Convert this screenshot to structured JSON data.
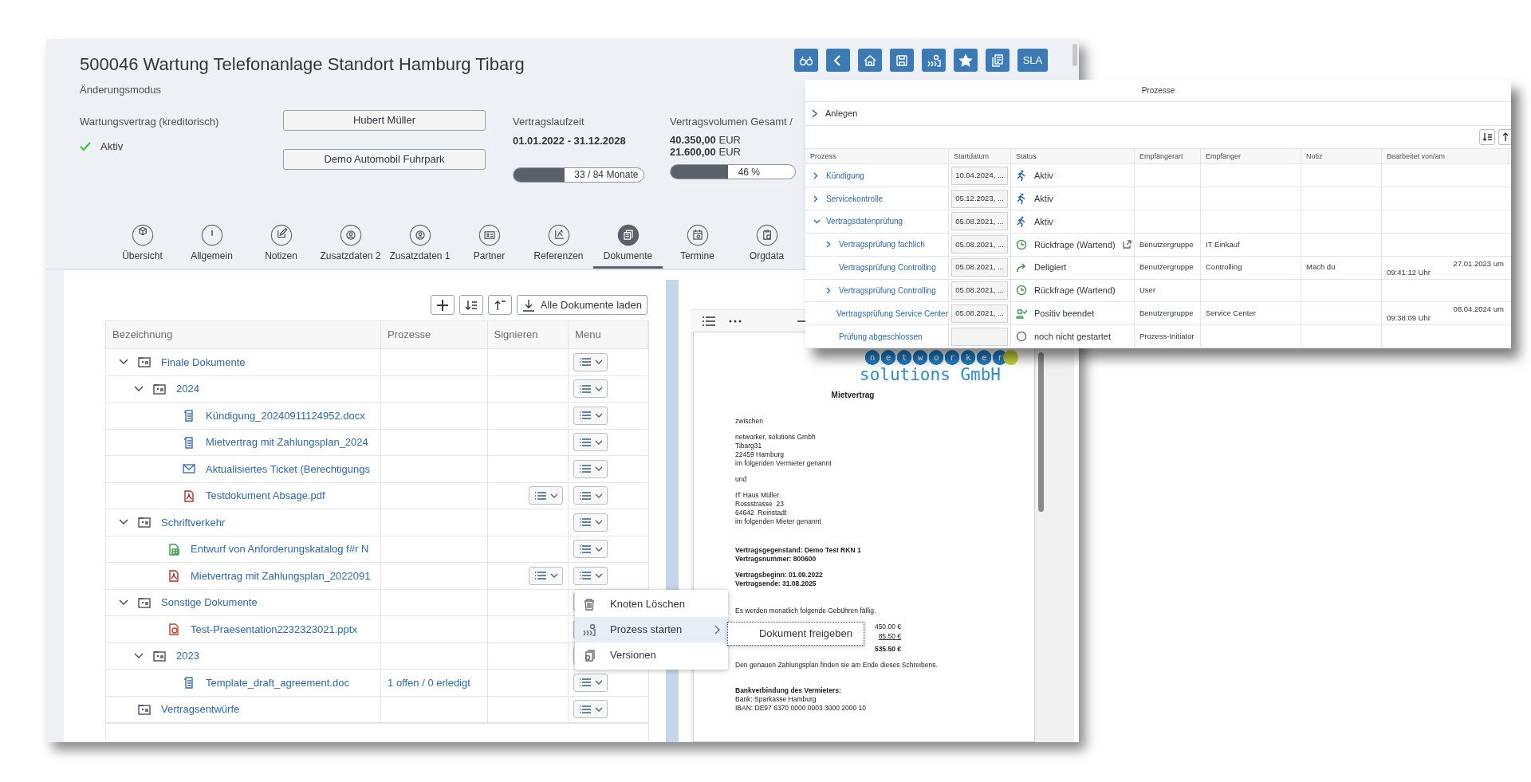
{
  "header": {
    "title": "500046 Wartung Telefonanlage Standort Hamburg Tibarg",
    "subtitle": "Änderungsmodus",
    "actions": [
      {
        "kind": "glasses"
      },
      {
        "kind": "back"
      },
      {
        "kind": "home"
      },
      {
        "kind": "save"
      },
      {
        "kind": "process"
      },
      {
        "kind": "favorite"
      },
      {
        "kind": "copy"
      },
      {
        "kind": "text",
        "label": "SLA"
      }
    ],
    "contract": {
      "type": "Wartungsvertrag (kreditorisch)",
      "status": "Aktiv"
    },
    "partners": [
      "Hubert Müller",
      "Demo Automobil Fuhrpark"
    ],
    "term": {
      "label": "Vertragslaufzeit",
      "dates": "01.01.2022 - 31.12.2028",
      "level": 0.39,
      "reading": "33 / 84 Monate"
    },
    "volume": {
      "label": "Vertragsvolumen Gesamt /",
      "amounts": [
        "**40.350,00** EUR",
        "**21.600,00** EUR"
      ],
      "level": 0.46,
      "reading": "46 %"
    }
  },
  "tabs": [
    {
      "label": "Übersicht",
      "kind": "box",
      "selected": false
    },
    {
      "label": "Allgemein",
      "kind": "info",
      "selected": false
    },
    {
      "label": "Notizen",
      "kind": "edit",
      "selected": false
    },
    {
      "label": "Zusatzdaten 2",
      "kind": "person",
      "selected": false
    },
    {
      "label": "Zusatzdaten 1",
      "kind": "person",
      "selected": false
    },
    {
      "label": "Partner",
      "kind": "card",
      "selected": false
    },
    {
      "label": "Referenzen",
      "kind": "axes",
      "selected": false
    },
    {
      "label": "Dokumente",
      "kind": "documents",
      "selected": true
    },
    {
      "label": "Termine",
      "kind": "calendar",
      "selected": false
    },
    {
      "label": "Orgdata",
      "kind": "clipboard",
      "selected": false
    }
  ],
  "documents": {
    "toolbar": [
      {
        "kind": "add"
      },
      {
        "kind": "sort_down"
      },
      {
        "kind": "sort_up"
      },
      {
        "kind": "download",
        "label": "Alle Dokumente laden"
      }
    ],
    "columns": [
      "Bezeichnung",
      "Prozesse",
      "Signieren",
      "Menu"
    ],
    "tree": [
      {
        "kind": "folder",
        "name": "Finale Dokumente",
        "expanded": true,
        "children": [
          {
            "kind": "folder",
            "name": "2024",
            "expanded": true,
            "children": [
              {
                "kind": "word",
                "name": "Kündigung_20240911124952.docx"
              },
              {
                "kind": "word",
                "name": "Mietvertrag mit Zahlungsplan_2024"
              },
              {
                "kind": "mail",
                "name": "Aktualisiertes Ticket (Berechtigungs"
              },
              {
                "kind": "pdf",
                "name": "Testdokument Absage.pdf",
                "signable": true
              }
            ]
          }
        ]
      },
      {
        "kind": "folder",
        "name": "Schriftverkehr",
        "expanded": true,
        "children": [
          {
            "kind": "sheet",
            "name": "Entwurf von Anforderungskatalog f#r N"
          },
          {
            "kind": "pdf",
            "name": "Mietvertrag mit Zahlungsplan_2022091",
            "signable": true
          }
        ]
      },
      {
        "kind": "folder",
        "name": "Sonstige Dokumente",
        "expanded": true,
        "children": [
          {
            "kind": "slides",
            "name": "Test-Praesentation2232323021.pptx"
          },
          {
            "kind": "folder",
            "name": "2023",
            "expanded": true,
            "children": [
              {
                "kind": "word",
                "name": "Template_draft_agreement.doc",
                "processes": "1 offen / 0 erledigt"
              }
            ]
          }
        ]
      },
      {
        "kind": "folder",
        "name": "Vertragsentwürfe"
      }
    ]
  },
  "context_menu": {
    "items": [
      {
        "kind": "trash",
        "label": "Knoten Löschen",
        "selected": false
      },
      {
        "kind": "process",
        "label": "Prozess starten",
        "selected": true,
        "submenu": [
          "Dokument freigeben"
        ]
      },
      {
        "kind": "versions",
        "label": "Versionen",
        "selected": false
      }
    ]
  },
  "preview": {
    "logo": "networker",
    "logo_sub": "solutions GmbH",
    "title": "Mietvertrag",
    "blocks": [
      {
        "kind": "text",
        "lines": [
          "zwischen"
        ]
      },
      {
        "kind": "text",
        "lines": [
          "networker, solutions Gmbh",
          "Tibarg31",
          "22459 Hamburg",
          "im folgenden Vermieter genannt"
        ]
      },
      {
        "kind": "text",
        "lines": [
          "und"
        ]
      },
      {
        "kind": "text",
        "lines": [
          "IT Haus Müller",
          "Rossstrasse  23",
          "64642  Reinstadt",
          "im folgenden Mieter genannt"
        ]
      },
      {
        "kind": "bold",
        "lines": [
          "Vertragsgegenstand: Demo Test RKN 1",
          "Vertragsnummer: 800600"
        ]
      },
      {
        "kind": "bold",
        "lines": [
          "Vertragsbeginn: 01.09.2022",
          "Vertragsende: 31.08.2025"
        ]
      },
      {
        "kind": "text",
        "lines": [
          "Es werden monatlich folgende Gebühren fällig."
        ]
      },
      {
        "kind": "fees",
        "amounts": [
          {
            "kind": "plain",
            "value": "450.00 €"
          },
          {
            "kind": "underlined",
            "value": "85.50 €"
          },
          {
            "kind": "total",
            "value": "535.50 €"
          }
        ]
      },
      {
        "kind": "text",
        "lines": [
          "Den genauen Zahlungsplan finden sie am Ende dieses Schreibens."
        ]
      },
      {
        "kind": "bank",
        "lines": [
          "Bankverbindung des Vermieters:",
          "Bank: Sparkasse Hamburg",
          "IBAN: DE97 6370 0000 0003 3000 2000 10"
        ]
      }
    ]
  },
  "processes": {
    "title": "Prozesse",
    "create": "Anlegen",
    "columns": [
      "Prozess",
      "Startdatum",
      "Status",
      "Empfängerart",
      "Empfänger",
      "Notiz",
      "Bearbeitet von/am"
    ],
    "rows": [
      {
        "name": "Kündigung",
        "expanded": false,
        "start": "10.04.2024, ...",
        "status": {
          "kind": "active",
          "label": "Aktiv"
        }
      },
      {
        "name": "Servicekontrolle",
        "expanded": false,
        "start": "05.12.2023, ...",
        "status": {
          "kind": "active",
          "label": "Aktiv"
        }
      },
      {
        "name": "Vertragsdatenprüfung",
        "expanded": true,
        "start": "05.08.2021, ...",
        "status": {
          "kind": "active",
          "label": "Aktiv"
        },
        "children": [
          {
            "name": "Vertragsprüfung fachlich",
            "expanded": false,
            "start": "05.08.2021, ...",
            "status": {
              "kind": "waiting",
              "label": "Rückfrage (Wartend)",
              "link": true
            },
            "recipient_type": "Benutzergruppe",
            "recipient": "IT Einkauf"
          },
          {
            "name": "Vertragsprüfung Controlling",
            "start": "05.08.2021, ...",
            "status": {
              "kind": "delegated",
              "label": "Deligiert"
            },
            "recipient_type": "Benutzergruppe",
            "recipient": "Controlling",
            "note": "Mach du",
            "edited": [
              "27.01.2023 um",
              "09:41:12 Uhr"
            ]
          },
          {
            "name": "Vertragsprüfung Controlling",
            "expanded": false,
            "start": "05.08.2021, ...",
            "status": {
              "kind": "waiting",
              "label": "Rückfrage (Wartend)"
            },
            "recipient_type": "User"
          },
          {
            "name": "Vertragsprüfung Service Center",
            "start": "05.08.2021, ...",
            "status": {
              "kind": "done",
              "label": "Positiv beendet"
            },
            "recipient_type": "Benutzergruppe",
            "recipient": "Service Center",
            "edited": [
              "08.04.2024 um",
              "09:38:09 Uhr"
            ]
          },
          {
            "name": "Prüfung abgeschlossen",
            "status": {
              "kind": "not_started",
              "label": "noch nicht gestartet"
            },
            "recipient_type": "Prozess-Initiator"
          }
        ]
      }
    ]
  }
}
